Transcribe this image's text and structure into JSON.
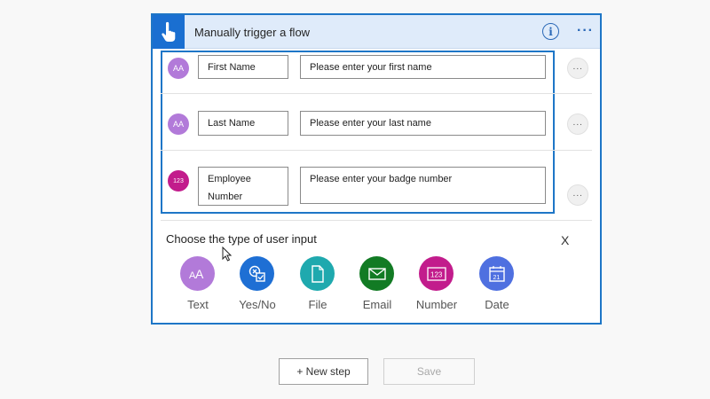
{
  "card": {
    "title": "Manually trigger a flow",
    "info_glyph": "i",
    "more_glyph": "···"
  },
  "inputs": [
    {
      "icon": "text-icon",
      "avatar_text": "AA",
      "color": "#b27ad9",
      "name": "First Name",
      "placeholder": "Please enter your first name",
      "more": "···"
    },
    {
      "icon": "text-icon",
      "avatar_text": "AA",
      "color": "#b27ad9",
      "name": "Last Name",
      "placeholder": "Please enter your last name",
      "more": "···"
    },
    {
      "icon": "number-icon",
      "avatar_text": "123",
      "color": "#c21c8c",
      "name": "Employee Number",
      "placeholder": "Please enter your badge number",
      "more": "···"
    }
  ],
  "chooser": {
    "title": "Choose the type of user input",
    "close": "X",
    "options": [
      {
        "label": "Text",
        "icon": "text-icon",
        "color": "#b27ad9"
      },
      {
        "label": "Yes/No",
        "icon": "yes-no-icon",
        "color": "#1e6fd4"
      },
      {
        "label": "File",
        "icon": "file-icon",
        "color": "#1fa9ae"
      },
      {
        "label": "Email",
        "icon": "email-icon",
        "color": "#127b24"
      },
      {
        "label": "Number",
        "icon": "number-icon",
        "color": "#c21c8c"
      },
      {
        "label": "Date",
        "icon": "date-icon",
        "color": "#4f70e0"
      }
    ]
  },
  "actions": {
    "new_step": "+ New step",
    "save": "Save"
  }
}
